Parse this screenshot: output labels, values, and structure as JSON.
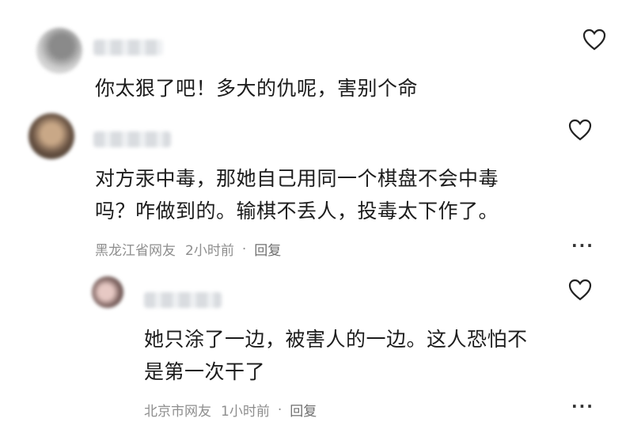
{
  "comments": [
    {
      "text_lines": [
        "你太狠了吧！多大的仇呢，害别个命"
      ],
      "avatar_colors": [
        "#6d6d6d",
        "#bdbdbd"
      ]
    },
    {
      "text_lines": [
        "对方汞中毒，那她自己用同一个棋盘不会中毒",
        "吗？咋做到的。输棋不丢人，投毒太下作了。"
      ],
      "location": "黑龙江省网友",
      "time": "2小时前",
      "separator": "·",
      "reply_label": "回复",
      "more_label": "···",
      "avatar_colors": [
        "#3a2f25",
        "#c9a887"
      ]
    },
    {
      "text_lines": [
        "她只涂了一边，被害人的一边。这人恐怕不",
        "是第一次干了"
      ],
      "location": "北京市网友",
      "time": "1小时前",
      "separator": "·",
      "reply_label": "回复",
      "more_label": "···",
      "avatar_colors": [
        "#5a4a48",
        "#e7c9c4"
      ]
    }
  ]
}
